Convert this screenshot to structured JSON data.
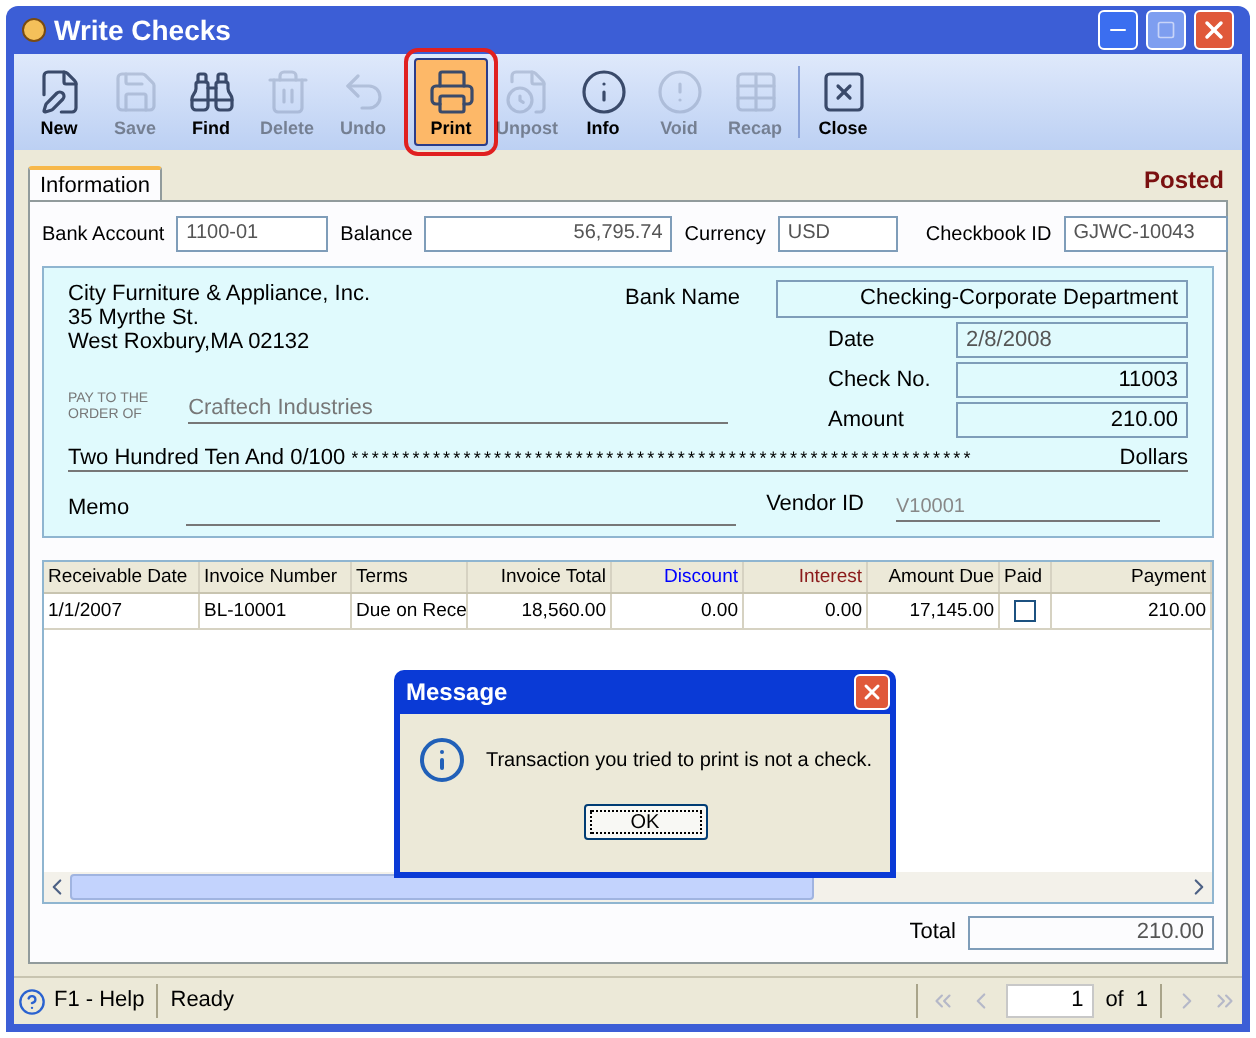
{
  "window": {
    "title": "Write Checks"
  },
  "toolbar": [
    {
      "label": "New",
      "kind": "new",
      "disabled": false,
      "highlighted": false
    },
    {
      "label": "Save",
      "kind": "save",
      "disabled": true,
      "highlighted": false
    },
    {
      "label": "Find",
      "kind": "find",
      "disabled": false,
      "highlighted": false
    },
    {
      "label": "Delete",
      "kind": "delete",
      "disabled": true,
      "highlighted": false
    },
    {
      "label": "Undo",
      "kind": "undo",
      "disabled": true,
      "highlighted": false
    },
    {
      "label": "Print",
      "kind": "print",
      "disabled": false,
      "highlighted": true
    },
    {
      "label": "Unpost",
      "kind": "unpost",
      "disabled": true,
      "highlighted": false
    },
    {
      "label": "Info",
      "kind": "info",
      "disabled": false,
      "highlighted": false
    },
    {
      "label": "Void",
      "kind": "void",
      "disabled": true,
      "highlighted": false
    },
    {
      "label": "Recap",
      "kind": "recap",
      "disabled": true,
      "highlighted": false
    },
    {
      "label": "Close",
      "kind": "close",
      "disabled": false,
      "highlighted": false
    }
  ],
  "tabs": [
    {
      "label": "Information",
      "selected": true
    }
  ],
  "status_label": "Posted",
  "header_fields": [
    {
      "label": "Bank Account",
      "value": "1100-01",
      "kind": "text"
    },
    {
      "label": "Balance",
      "value": "56,795.74",
      "kind": "amount"
    },
    {
      "label": "Currency",
      "value": "USD",
      "kind": "text"
    },
    {
      "label": "Checkbook ID",
      "value": "GJWC-10043",
      "kind": "text"
    }
  ],
  "check": {
    "payer_lines": [
      "City Furniture & Appliance, Inc.",
      "35 Myrthe St.",
      "West Roxbury,MA 02132"
    ],
    "bank_name": {
      "label": "Bank Name",
      "value": "Checking-Corporate Department"
    },
    "date": {
      "label": "Date",
      "value": "2/8/2008"
    },
    "check_no": {
      "label": "Check No.",
      "value": "11003"
    },
    "amount": {
      "label": "Amount",
      "value": "210.00"
    },
    "pay_to_lines": [
      "PAY TO THE",
      "ORDER OF"
    ],
    "payee": "Craftech Industries",
    "amount_words": "Two Hundred Ten And 0/100",
    "stars": "*************************************************************",
    "dollars": "Dollars",
    "memo_label": "Memo",
    "vendor_id": {
      "label": "Vendor ID",
      "value": "V10001"
    }
  },
  "grid": {
    "columns": [
      {
        "label": "Receivable Date",
        "kind": "text",
        "color": "#000000"
      },
      {
        "label": "Invoice Number",
        "kind": "text",
        "color": "#000000"
      },
      {
        "label": "Terms",
        "kind": "text",
        "color": "#000000"
      },
      {
        "label": "Invoice Total",
        "kind": "number",
        "color": "#000000"
      },
      {
        "label": "Discount",
        "kind": "number",
        "color": "#0000ff"
      },
      {
        "label": "Interest",
        "kind": "number",
        "color": "#8b1a1a"
      },
      {
        "label": "Amount Due",
        "kind": "number",
        "color": "#000000"
      },
      {
        "label": "Paid",
        "kind": "check",
        "color": "#000000"
      },
      {
        "label": "Payment",
        "kind": "number",
        "color": "#000000"
      }
    ],
    "rows": [
      {
        "cells": [
          "1/1/2007",
          "BL-10001",
          "Due on Rece",
          "18,560.00",
          "0.00",
          "0.00",
          "17,145.00",
          "",
          "210.00"
        ],
        "paid": false
      }
    ]
  },
  "total": {
    "label": "Total",
    "value": "210.00"
  },
  "dialog": {
    "title": "Message",
    "message": "Transaction you tried to print is not a check.",
    "button": "OK"
  },
  "status_bar": {
    "help": "F1 - Help",
    "status": "Ready",
    "page": "1",
    "of": "of",
    "pages": "1"
  }
}
